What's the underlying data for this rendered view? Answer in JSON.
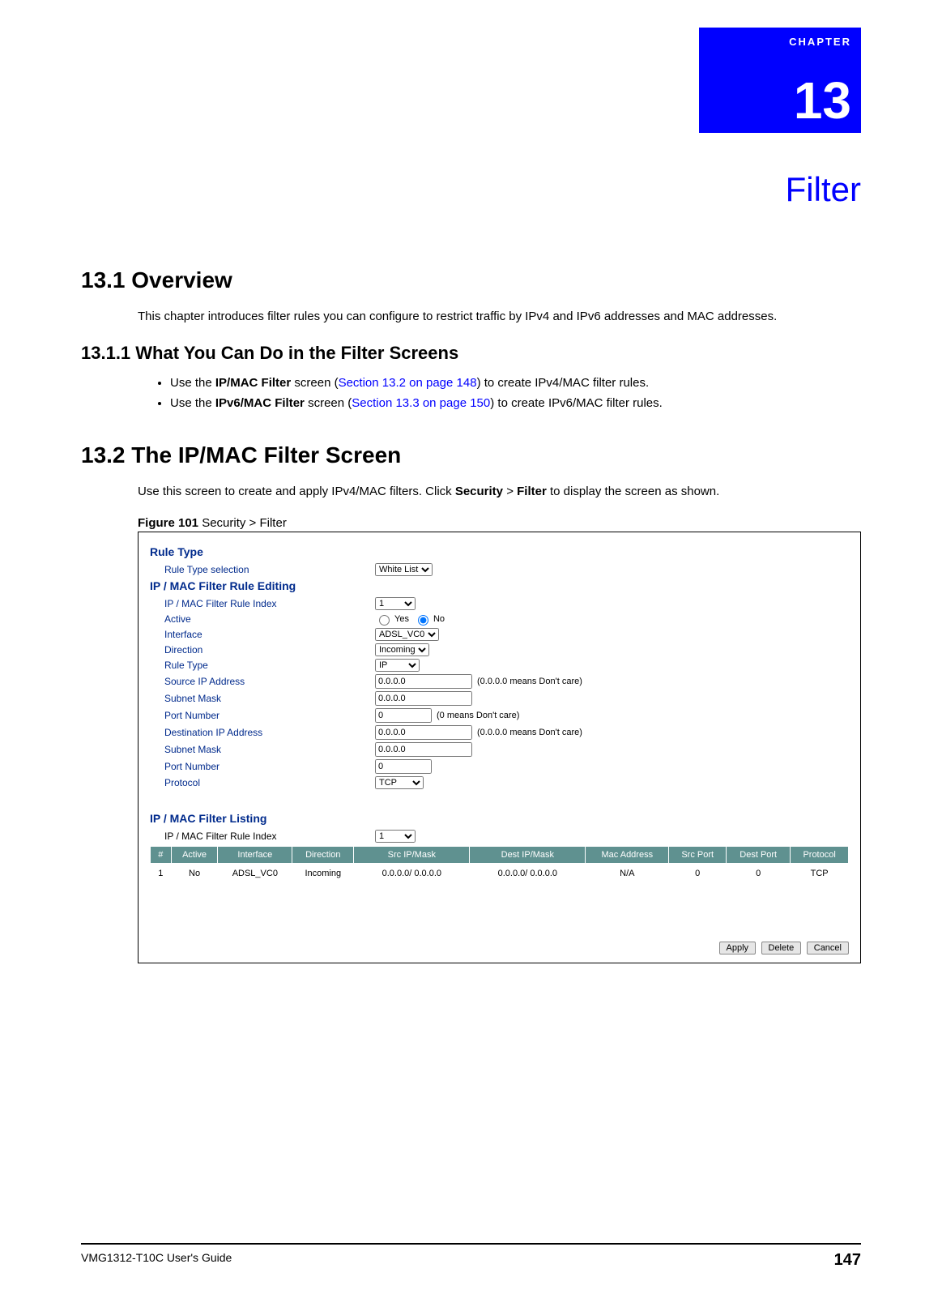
{
  "chapter": {
    "label": "CHAPTER",
    "number": "13",
    "title": "Filter"
  },
  "s1": {
    "heading": "13.1  Overview",
    "p1": "This chapter introduces filter rules you can configure to restrict traffic by IPv4 and IPv6 addresses and MAC addresses.",
    "sub1_heading": "13.1.1  What You Can Do in the Filter Screens",
    "b1_pre": "Use the ",
    "b1_bold": "IP/MAC Filter",
    "b1_mid": " screen (",
    "b1_link": "Section 13.2 on page 148",
    "b1_post": ") to create IPv4/MAC filter rules.",
    "b2_pre": "Use the ",
    "b2_bold": "IPv6/MAC Filter",
    "b2_mid": " screen (",
    "b2_link": "Section 13.3 on page 150",
    "b2_post": ") to create IPv6/MAC filter rules."
  },
  "s2": {
    "heading": "13.2  The IP/MAC Filter Screen",
    "p1_pre": "Use this screen to create and apply IPv4/MAC filters. Click ",
    "p1_b1": "Security",
    "p1_mid": " > ",
    "p1_b2": "Filter",
    "p1_post": " to display the screen as shown.",
    "fig_label": "Figure 101",
    "fig_caption": "   Security > Filter"
  },
  "form": {
    "rule_type_section": "Rule Type",
    "rule_type_sel_label": "Rule Type selection",
    "rule_type_sel_value": "White List",
    "editing_section": "IP / MAC Filter Rule Editing",
    "rule_index_label": "IP / MAC Filter Rule Index",
    "rule_index_value": "1",
    "active_label": "Active",
    "active_yes": "Yes",
    "active_no": "No",
    "interface_label": "Interface",
    "interface_value": "ADSL_VC0",
    "direction_label": "Direction",
    "direction_value": "Incoming",
    "ruletype2_label": "Rule Type",
    "ruletype2_value": "IP",
    "src_ip_label": "Source IP Address",
    "src_ip_value": "0.0.0.0",
    "src_ip_hint": "(0.0.0.0 means Don't care)",
    "subnet1_label": "Subnet Mask",
    "subnet1_value": "0.0.0.0",
    "port1_label": "Port Number",
    "port1_value": "0",
    "port1_hint": "(0 means Don't care)",
    "dst_ip_label": "Destination IP Address",
    "dst_ip_value": "0.0.0.0",
    "dst_ip_hint": "(0.0.0.0 means Don't care)",
    "subnet2_label": "Subnet Mask",
    "subnet2_value": "0.0.0.0",
    "port2_label": "Port Number",
    "port2_value": "0",
    "protocol_label": "Protocol",
    "protocol_value": "TCP",
    "listing_section": "IP / MAC Filter Listing",
    "listing_index_label": "IP / MAC Filter Rule Index",
    "listing_index_value": "1"
  },
  "table": {
    "headers": [
      "#",
      "Active",
      "Interface",
      "Direction",
      "Src IP/Mask",
      "Dest IP/Mask",
      "Mac Address",
      "Src Port",
      "Dest Port",
      "Protocol"
    ],
    "row": [
      "1",
      "No",
      "ADSL_VC0",
      "Incoming",
      "0.0.0.0/ 0.0.0.0",
      "0.0.0.0/ 0.0.0.0",
      "N/A",
      "0",
      "0",
      "TCP"
    ]
  },
  "buttons": {
    "apply": "Apply",
    "delete": "Delete",
    "cancel": "Cancel"
  },
  "footer": {
    "guide": "VMG1312-T10C User's Guide",
    "page": "147"
  }
}
